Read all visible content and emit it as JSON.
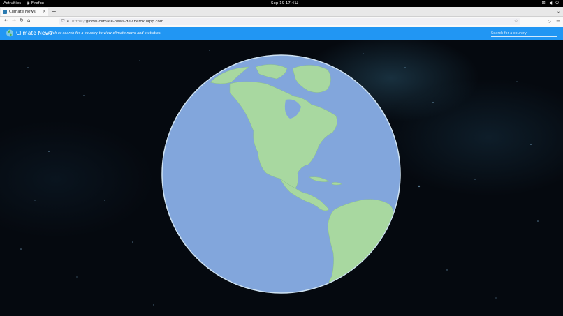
{
  "os_bar": {
    "activities": "Activities",
    "app_name": "Firefox",
    "clock": "Sep 19  17:41",
    "icons": [
      "network-icon",
      "volume-icon",
      "power-icon"
    ]
  },
  "browser": {
    "tab_title": "Climate News",
    "tab_close": "×",
    "new_tab": "+",
    "tab_list": "⌄",
    "url_prefix": "https://",
    "url_host": "global-climate-news-dev.herokuapp.com",
    "back": "←",
    "forward": "→",
    "reload": "↻",
    "home": "⌂",
    "bookmark": "☆",
    "menu": "≡"
  },
  "app": {
    "title": "Climate News",
    "subtitle": "- Click or search for a country to view climate news and statistics.",
    "search_placeholder": "Search for a country"
  },
  "colors": {
    "header": "#2196f3",
    "ocean": "#82a6dc",
    "land": "#a8d8a0",
    "space": "#05090f"
  }
}
